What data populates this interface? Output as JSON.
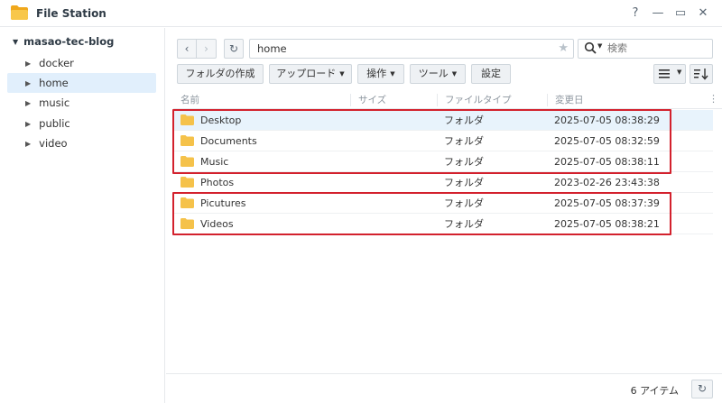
{
  "window": {
    "title": "File Station",
    "help_label": "?",
    "minimize_label": "—",
    "maximize_label": "▭",
    "close_label": "✕"
  },
  "sidebar": {
    "root": "masao-tec-blog",
    "items": [
      {
        "label": "docker",
        "active": false
      },
      {
        "label": "home",
        "active": true
      },
      {
        "label": "music",
        "active": false
      },
      {
        "label": "public",
        "active": false
      },
      {
        "label": "video",
        "active": false
      }
    ]
  },
  "toolbar": {
    "back_label": "‹",
    "forward_label": "›",
    "refresh_label": "↻",
    "path": "home",
    "search_placeholder": "検索",
    "create_folder_label": "フォルダの作成",
    "upload_label": "アップロード",
    "action_label": "操作",
    "tools_label": "ツール",
    "settings_label": "設定"
  },
  "columns": {
    "name": "名前",
    "size": "サイズ",
    "type": "ファイルタイプ",
    "modified": "変更日"
  },
  "files": [
    {
      "name": "Desktop",
      "size": "",
      "type": "フォルダ",
      "modified": "2025-07-05 08:38:29"
    },
    {
      "name": "Documents",
      "size": "",
      "type": "フォルダ",
      "modified": "2025-07-05 08:32:59"
    },
    {
      "name": "Music",
      "size": "",
      "type": "フォルダ",
      "modified": "2025-07-05 08:38:11"
    },
    {
      "name": "Photos",
      "size": "",
      "type": "フォルダ",
      "modified": "2023-02-26 23:43:38"
    },
    {
      "name": "Picutures",
      "size": "",
      "type": "フォルダ",
      "modified": "2025-07-05 08:37:39"
    },
    {
      "name": "Videos",
      "size": "",
      "type": "フォルダ",
      "modified": "2025-07-05 08:38:21"
    }
  ],
  "status": {
    "item_count": "6 アイテム",
    "refresh_label": "↻"
  },
  "colors": {
    "highlight": "#d3212d",
    "folder": "#f5c24a",
    "selection": "#e1effc"
  }
}
